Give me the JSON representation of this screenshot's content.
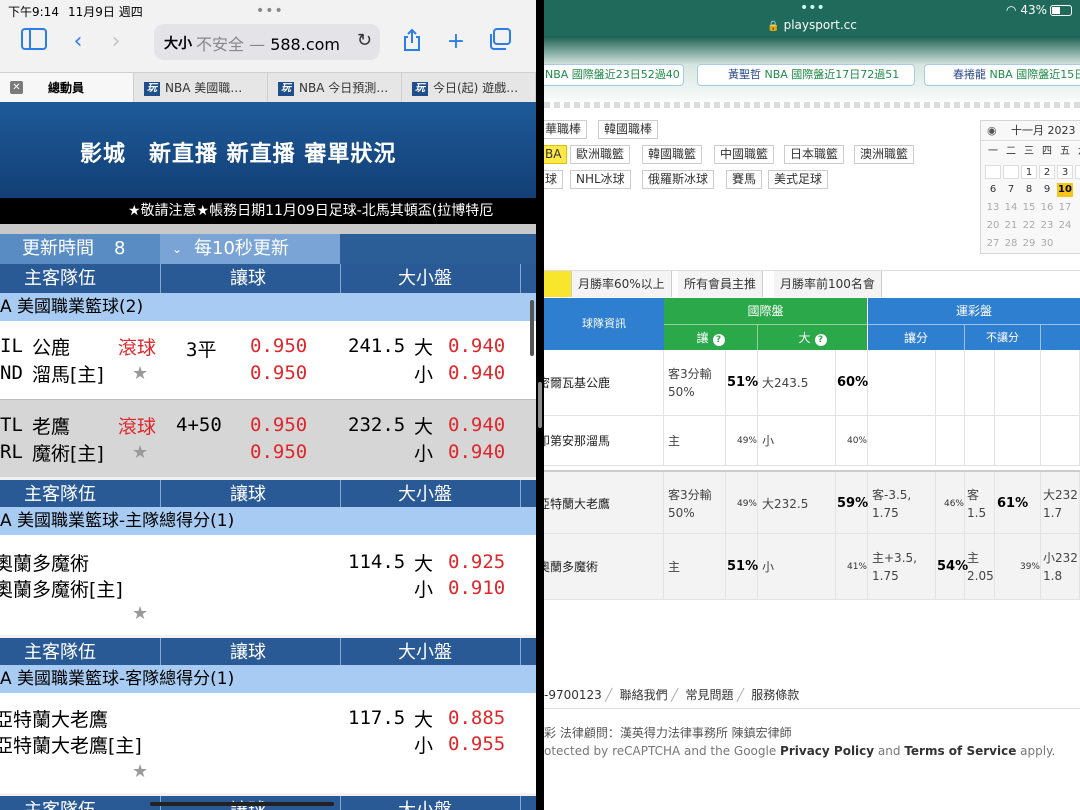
{
  "left": {
    "status": {
      "time": "下午9:14",
      "date": "11月9日 週四"
    },
    "toolbar": {
      "text_size": "大小",
      "url_prefix": "不安全 — ",
      "url_domain": "588.com"
    },
    "tabs": [
      {
        "label": "總動員"
      },
      {
        "label": "NBA 美國職…"
      },
      {
        "label": "NBA 今日預測…"
      },
      {
        "label": "今日(起) 遊戲…"
      }
    ],
    "site": {
      "title": "影城　新直播 新直播 審單狀況",
      "marquee": "★敬請注意★帳務日期11月09日足球-北馬其頓盃(拉博特厄"
    },
    "update": {
      "label": "更新時間",
      "value": "8",
      "selected": "每10秒更新"
    },
    "headers": {
      "team": "主客隊伍",
      "handicap": "讓球",
      "over_under": "大小盤"
    },
    "sections": [
      {
        "league": "A  美國職業籃球(2)",
        "games": [
          {
            "code1": "IL",
            "team1": "公鹿",
            "code2": "ND",
            "team2": "溜馬[主]",
            "live": "滾球",
            "line": "3平",
            "odds1": "0.950",
            "odds2": "0.950",
            "total": "241.5",
            "big": "大",
            "small": "小",
            "ou1": "0.940",
            "ou2": "0.940"
          },
          {
            "code1": "TL",
            "team1": "老鷹",
            "code2": "RL",
            "team2": "魔術[主]",
            "live": "滾球",
            "line": "4+50",
            "odds1": "0.950",
            "odds2": "0.950",
            "total": "232.5",
            "big": "大",
            "small": "小",
            "ou1": "0.940",
            "ou2": "0.940"
          }
        ]
      },
      {
        "league": "A  美國職業籃球-主隊總得分(1)",
        "games": [
          {
            "team1": "奧蘭多魔術",
            "team2": "奧蘭多魔術[主]",
            "total": "114.5",
            "big": "大",
            "small": "小",
            "ou1": "0.925",
            "ou2": "0.910"
          }
        ]
      },
      {
        "league": "A  美國職業籃球-客隊總得分(1)",
        "games": [
          {
            "team1": "亞特蘭大老鷹",
            "team2": "亞特蘭大老鷹[主]",
            "total": "117.5",
            "big": "大",
            "small": "小",
            "ou1": "0.885",
            "ou2": "0.955"
          }
        ]
      }
    ]
  },
  "right": {
    "status": {
      "wifi": "43%"
    },
    "url": "playsport.cc",
    "strip": [
      {
        "prefix": "NBA 國際盤近23日52過40",
        "name": ""
      },
      {
        "prefix": "NBA 國際盤近17日72過51",
        "name": "黃聖哲"
      },
      {
        "prefix": "NBA 國際盤近15日",
        "name": "春捲龍"
      }
    ],
    "categories": [
      [
        "華職棒",
        "韓國職棒"
      ],
      [
        "BA",
        "歐洲職籃",
        "韓國職籃",
        "中國職籃",
        "日本職籃",
        "澳洲職籃"
      ],
      [
        "球",
        "NHL冰球",
        "俄羅斯冰球",
        "賽馬",
        "美式足球"
      ]
    ],
    "calendar": {
      "title": "十一月 2023",
      "weekdays": [
        "一",
        "二",
        "三",
        "四",
        "五",
        "六"
      ],
      "weeks": [
        [
          "",
          "",
          "1",
          "2",
          "3",
          ""
        ],
        [
          "6",
          "7",
          "8",
          "9",
          "10",
          ""
        ],
        [
          "13",
          "14",
          "15",
          "16",
          "17",
          ""
        ],
        [
          "20",
          "21",
          "22",
          "23",
          "24",
          ""
        ],
        [
          "27",
          "28",
          "29",
          "30",
          "",
          ""
        ]
      ],
      "today": "10"
    },
    "filters": [
      "月勝率60%以上",
      "所有會員主推",
      "月勝率前100名會"
    ],
    "table": {
      "team_info": "球隊資訊",
      "intl": "國際盤",
      "lottery": "運彩盤",
      "spread": "讓",
      "big": "大",
      "lot_spread": "讓分",
      "no_spread": "不讓分",
      "rows": [
        {
          "team": "密爾瓦基公鹿",
          "spread": "客3分輸\n50%",
          "sp_pct": "51%",
          "ou": "大243.5",
          "ou_pct": "60%",
          "l_sp": "",
          "l_sp_pct": "",
          "l_ns": "",
          "l_ns_pct": "",
          "l_ou": ""
        },
        {
          "team": "印第安那溜馬",
          "spread": "主",
          "sp_pct": "49%",
          "ou": "小",
          "ou_pct": "40%",
          "l_sp": "",
          "l_sp_pct": "",
          "l_ns": "",
          "l_ns_pct": "",
          "l_ou": ""
        },
        {
          "team": "亞特蘭大老鷹",
          "spread": "客3分輸\n50%",
          "sp_pct": "49%",
          "ou": "大232.5",
          "ou_pct": "59%",
          "l_sp": "客-3.5,\n1.75",
          "l_sp_pct": "46%",
          "l_ns": "客1.5",
          "l_ns_pct": "61%",
          "l_ou": "大232\n1.7"
        },
        {
          "team": "奧蘭多魔術",
          "spread": "主",
          "sp_pct": "51%",
          "ou": "小",
          "ou_pct": "41%",
          "l_sp": "主+3.5,\n1.75",
          "l_sp_pct": "54%",
          "l_ns": "主\n2.05",
          "l_ns_pct": "39%",
          "l_ou": "小232\n1.8"
        }
      ]
    },
    "footer": {
      "phone": "-9700123",
      "links": [
        "聯絡我們",
        "常見問題",
        "服務條款"
      ],
      "legal": "彩 法律顧問：漢英得力法律事務所 陳鎮宏律師",
      "recaptcha_pre": "otected by reCAPTCHA and the Google ",
      "privacy": "Privacy Policy",
      "and": " and ",
      "terms": "Terms of Service",
      "apply": " apply."
    }
  },
  "colors": {
    "accent": "#2a5a95",
    "red": "#e0262b",
    "green": "#2aa84a",
    "blue": "#2f7fd0"
  }
}
